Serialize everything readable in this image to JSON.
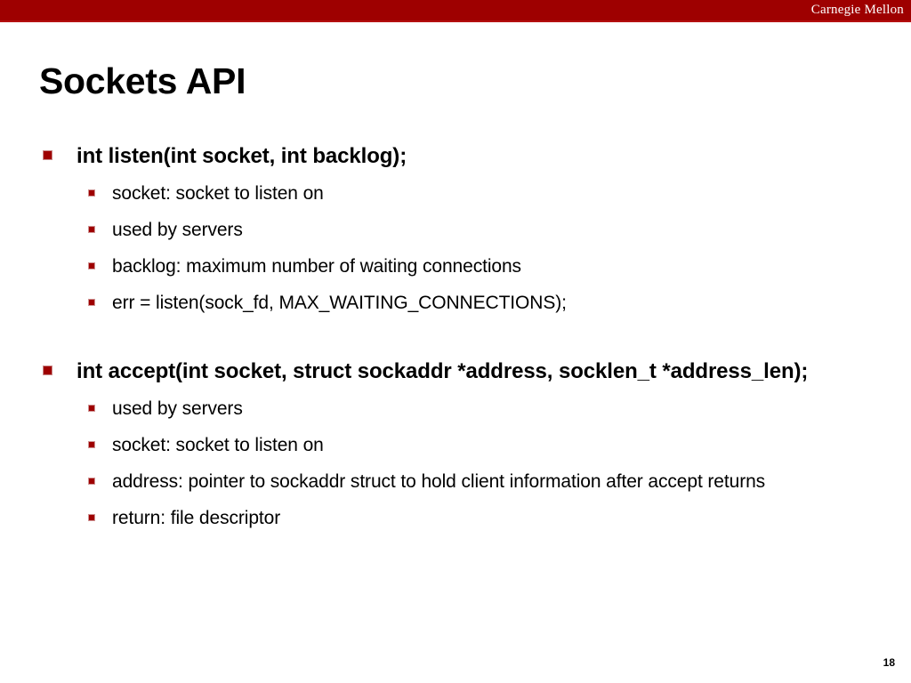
{
  "header": {
    "brand": "Carnegie Mellon",
    "bar_color": "#9e0000",
    "brand_color": "#ffffff"
  },
  "title": "Sockets API",
  "accent_color": "#9e0000",
  "text_color": "#000000",
  "bullets": [
    {
      "label": "int listen(int socket, int backlog);",
      "sub": [
        "socket: socket to listen on",
        "used by servers",
        "backlog: maximum number of waiting connections",
        "err = listen(sock_fd, MAX_WAITING_CONNECTIONS);"
      ]
    },
    {
      "label": "int accept(int socket, struct sockaddr *address, socklen_t *address_len);",
      "sub": [
        "used by servers",
        "socket: socket to listen on",
        "address: pointer to sockaddr struct to hold client information after accept returns",
        "return: file descriptor"
      ]
    }
  ],
  "page_number": "18"
}
